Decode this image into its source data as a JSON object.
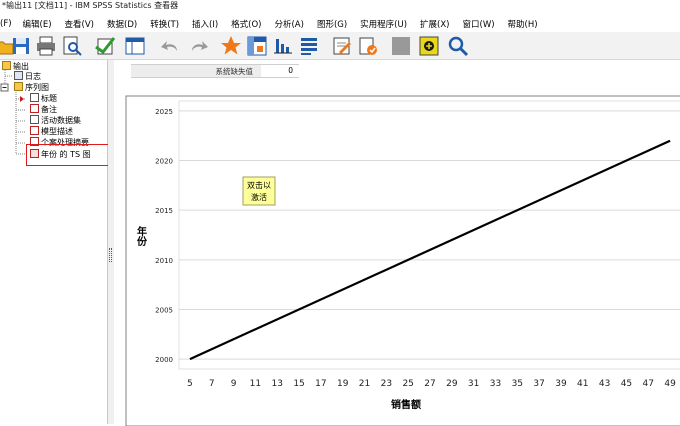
{
  "window": {
    "title": "*输出11 [文档11] - IBM SPSS Statistics 查看器"
  },
  "menu": [
    "(F)",
    "编辑(E)",
    "查看(V)",
    "数据(D)",
    "转换(T)",
    "插入(I)",
    "格式(O)",
    "分析(A)",
    "图形(G)",
    "实用程序(U)",
    "扩展(X)",
    "窗口(W)",
    "帮助(H)"
  ],
  "toolbar": {
    "icons": [
      "open-icon",
      "save-icon",
      "print-icon",
      "print-preview-icon",
      "export-icon",
      "goto-data-icon",
      "undo-icon",
      "redo-icon",
      "star-icon",
      "pivot-icon",
      "chart-icon",
      "list-icon",
      "edit-icon",
      "designate-icon",
      "gray-box-icon",
      "add-icon",
      "search-icon"
    ]
  },
  "tree": {
    "items": [
      {
        "label": "输出",
        "level": 0
      },
      {
        "label": "日志",
        "level": 1
      },
      {
        "label": "序列图",
        "level": 1
      },
      {
        "label": "标题",
        "level": 2
      },
      {
        "label": "备注",
        "level": 2
      },
      {
        "label": "活动数据集",
        "level": 2
      },
      {
        "label": "模型描述",
        "level": 2
      },
      {
        "label": "个案处理摘要",
        "level": 2
      },
      {
        "label": "年份 的 TS 图",
        "level": 2
      }
    ]
  },
  "summary": {
    "label": "系统缺失值",
    "value": "0"
  },
  "tooltip": {
    "line1": "双击以",
    "line2": "激活"
  },
  "colors": {
    "highlight": "#e0191a",
    "line": "#000000",
    "tooltip_bg": "#ffff99"
  },
  "chart_data": {
    "type": "line",
    "xlabel": "销售额",
    "ylabel": "年份",
    "x_ticks": [
      "5",
      "7",
      "9",
      "11",
      "13",
      "15",
      "17",
      "19",
      "21",
      "23",
      "25",
      "27",
      "29",
      "31",
      "33",
      "35",
      "37",
      "39",
      "41",
      "43",
      "45",
      "47",
      "49"
    ],
    "y_ticks": [
      2000,
      2005,
      2010,
      2015,
      2020,
      2025
    ],
    "ylim": [
      1999,
      2026
    ],
    "series": [
      {
        "x": [
          5,
          49
        ],
        "y": [
          2000,
          2022
        ]
      }
    ],
    "grid": true
  }
}
